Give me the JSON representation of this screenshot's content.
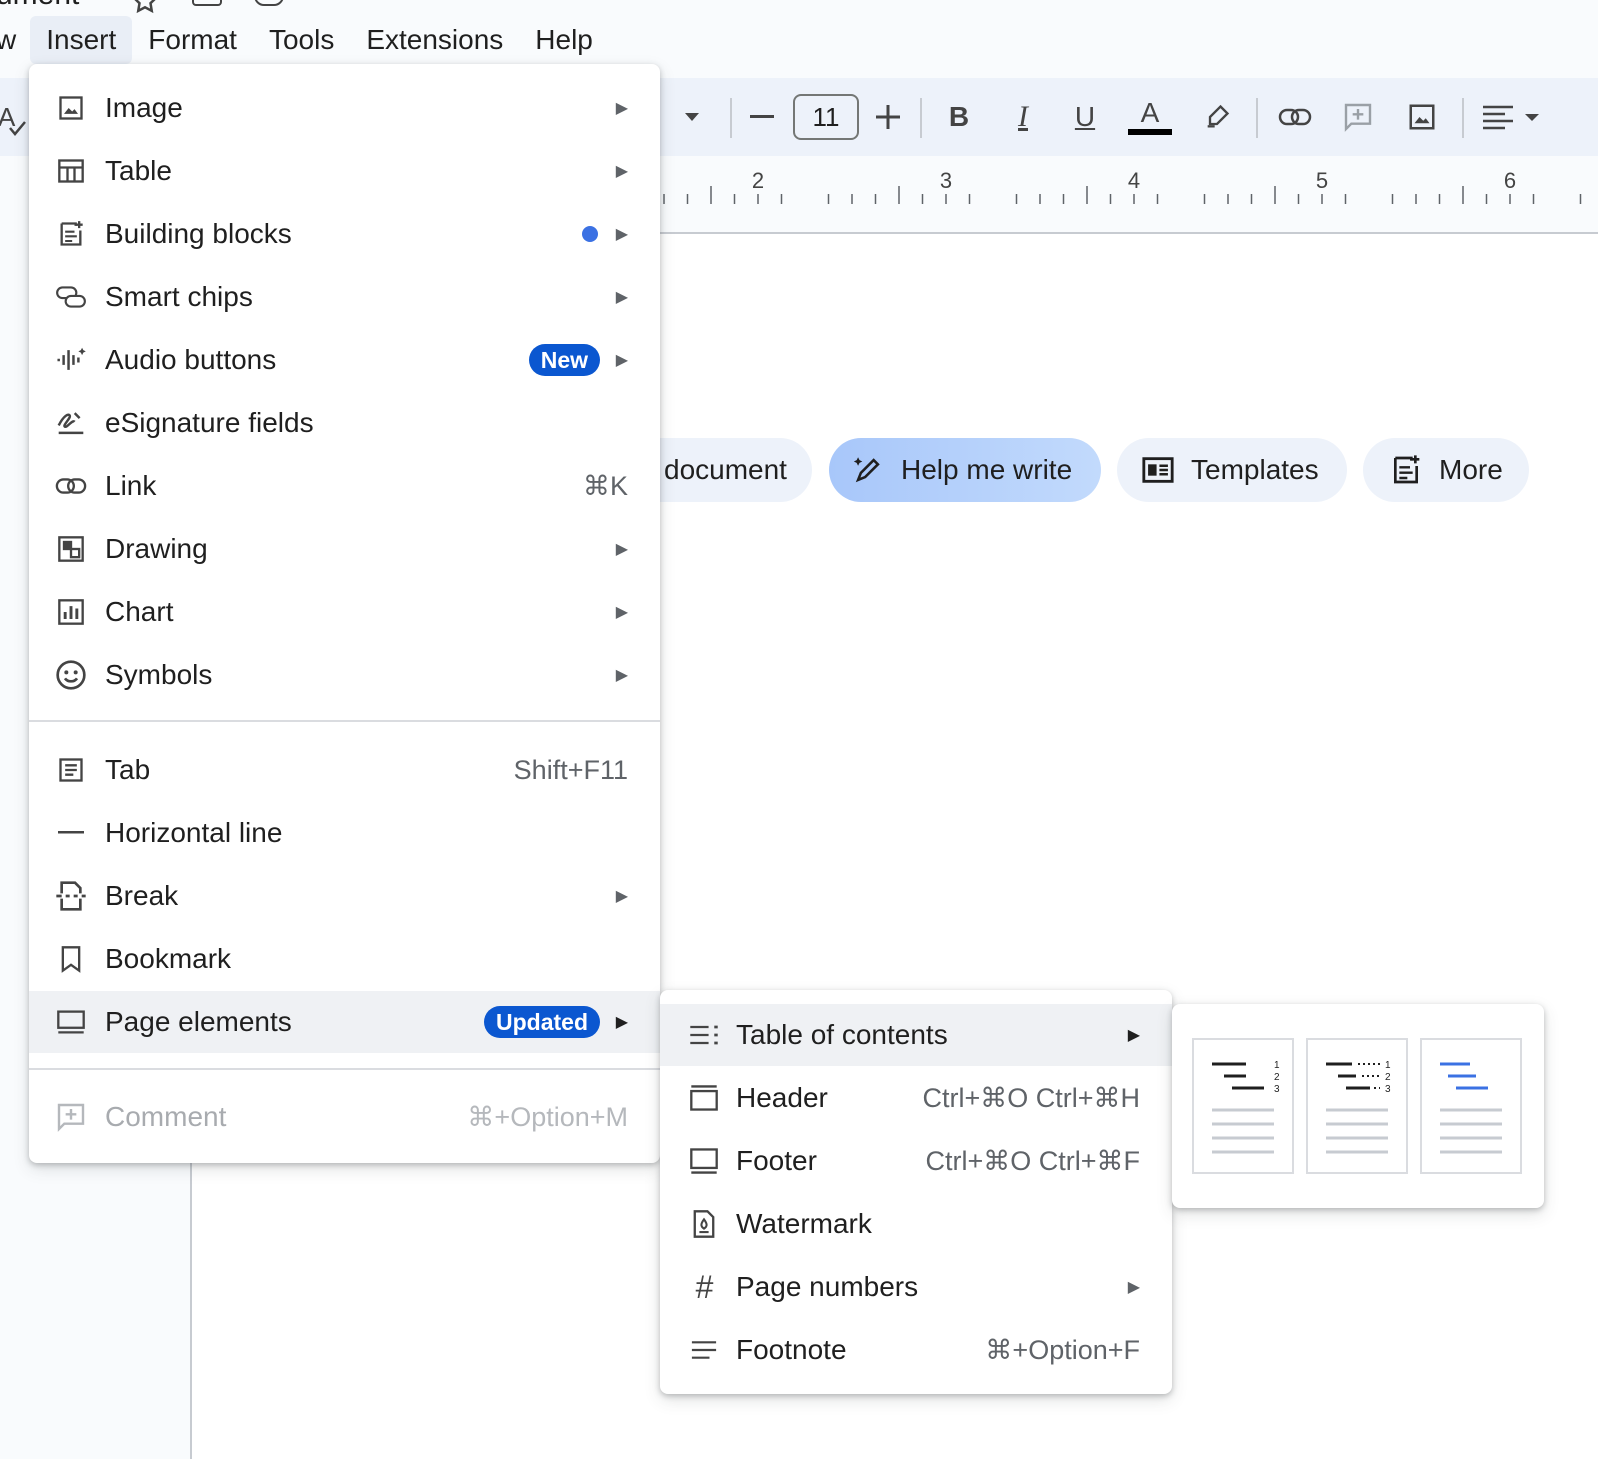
{
  "window": {
    "title_fragment": "ument"
  },
  "menubar": {
    "partial_item": "w",
    "items": [
      "Insert",
      "Format",
      "Tools",
      "Extensions",
      "Help"
    ],
    "active": "Insert"
  },
  "toolbar": {
    "spellcheck_label": "A",
    "font_size": "11",
    "bold": "B",
    "italic": "I",
    "underline": "U",
    "text_color": "A"
  },
  "ruler": {
    "numbers": [
      "2",
      "3",
      "4",
      "5",
      "6"
    ]
  },
  "chips": {
    "document": "document",
    "help_me_write": "Help me write",
    "templates": "Templates",
    "more": "More"
  },
  "insert_menu": {
    "items": [
      {
        "label": "Image",
        "icon": "image-icon",
        "submenu": true
      },
      {
        "label": "Table",
        "icon": "table-icon",
        "submenu": true
      },
      {
        "label": "Building blocks",
        "icon": "building-blocks-icon",
        "submenu": true,
        "dot": true
      },
      {
        "label": "Smart chips",
        "icon": "smart-chips-icon",
        "submenu": true
      },
      {
        "label": "Audio buttons",
        "icon": "audio-buttons-icon",
        "submenu": true,
        "badge": "New"
      },
      {
        "label": "eSignature fields",
        "icon": "esignature-icon"
      },
      {
        "label": "Link",
        "icon": "link-icon",
        "shortcut": "⌘K"
      },
      {
        "label": "Drawing",
        "icon": "drawing-icon",
        "submenu": true
      },
      {
        "label": "Chart",
        "icon": "chart-icon",
        "submenu": true
      },
      {
        "label": "Symbols",
        "icon": "symbols-icon",
        "submenu": true
      },
      {
        "label": "Tab",
        "icon": "tab-icon",
        "shortcut": "Shift+F11"
      },
      {
        "label": "Horizontal line",
        "icon": "horizontal-line-icon"
      },
      {
        "label": "Break",
        "icon": "break-icon",
        "submenu": true
      },
      {
        "label": "Bookmark",
        "icon": "bookmark-icon"
      },
      {
        "label": "Page elements",
        "icon": "page-elements-icon",
        "submenu": true,
        "badge": "Updated",
        "highlighted": true
      },
      {
        "label": "Comment",
        "icon": "comment-icon",
        "shortcut": "⌘+Option+M",
        "disabled": true
      }
    ]
  },
  "page_elements_menu": {
    "items": [
      {
        "label": "Table of contents",
        "icon": "table-of-contents-icon",
        "submenu": true,
        "highlighted": true
      },
      {
        "label": "Header",
        "icon": "header-icon",
        "shortcut": "Ctrl+⌘O Ctrl+⌘H"
      },
      {
        "label": "Footer",
        "icon": "footer-icon",
        "shortcut": "Ctrl+⌘O Ctrl+⌘F"
      },
      {
        "label": "Watermark",
        "icon": "watermark-icon"
      },
      {
        "label": "Page numbers",
        "icon": "page-numbers-icon",
        "submenu": true
      },
      {
        "label": "Footnote",
        "icon": "footnote-icon",
        "shortcut": "⌘+Option+F"
      }
    ]
  },
  "toc_options": {
    "with_numbers_digits": [
      "1",
      "2",
      "3"
    ],
    "styles": [
      "plain-text-with-numbers",
      "dotted-with-numbers",
      "blue-links"
    ]
  },
  "colors": {
    "accent": "#0b57d0",
    "highlight": "#eff1f4",
    "toolbar_bg": "#edf2fa",
    "link_blue": "#3b71e3"
  }
}
